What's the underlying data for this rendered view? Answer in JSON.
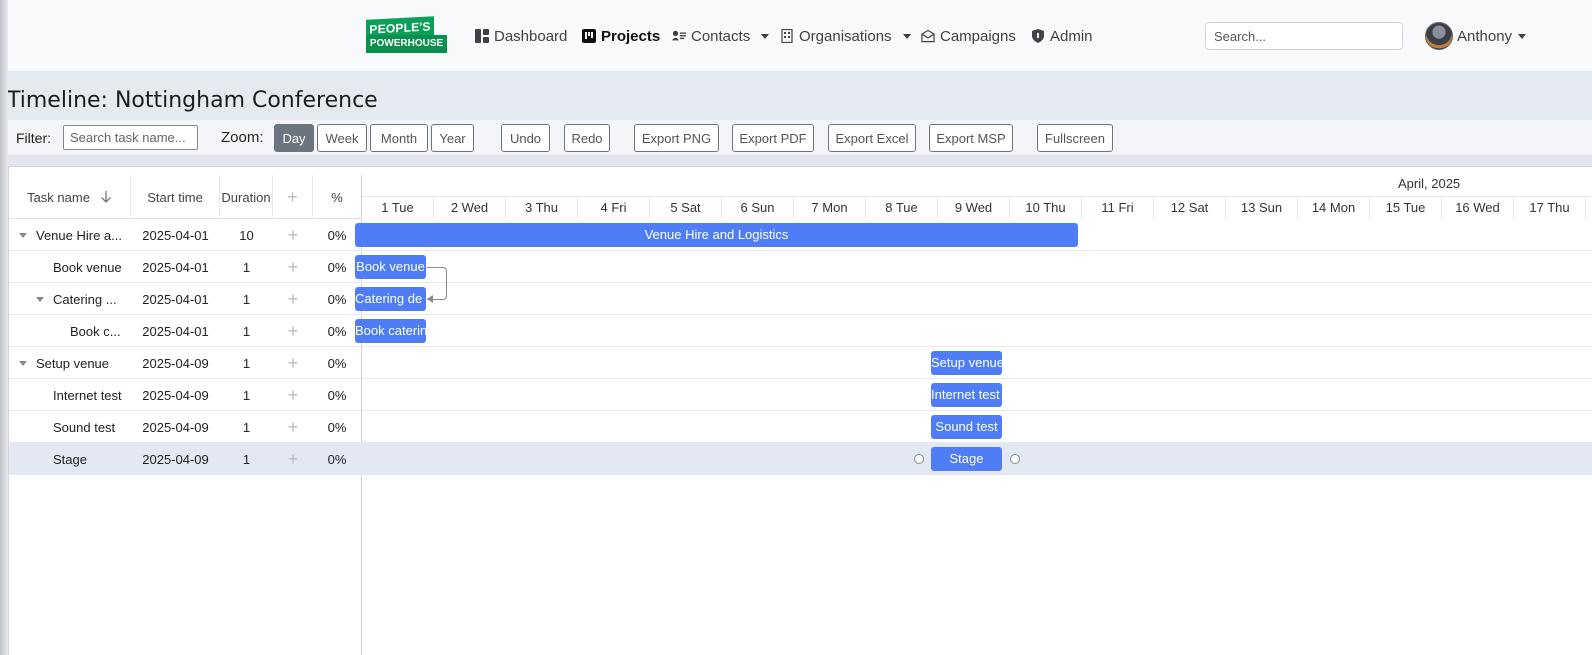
{
  "nav": {
    "logo_line1": "PEOPLE'S",
    "logo_line2": "POWERHOUSE",
    "items": [
      {
        "label": "Dashboard",
        "icon": "dashboard-icon"
      },
      {
        "label": "Projects",
        "icon": "projects-icon",
        "active": true
      },
      {
        "label": "Contacts",
        "icon": "contacts-icon",
        "dropdown": true
      },
      {
        "label": "Organisations",
        "icon": "building-icon",
        "dropdown": true
      },
      {
        "label": "Campaigns",
        "icon": "campaigns-icon"
      },
      {
        "label": "Admin",
        "icon": "shield-icon"
      }
    ],
    "search_placeholder": "Search...",
    "user_name": "Anthony"
  },
  "page": {
    "title": "Timeline: Nottingham Conference"
  },
  "toolbar": {
    "filter_label": "Filter:",
    "filter_placeholder": "Search task name...",
    "zoom_label": "Zoom:",
    "zoom_options": [
      "Day",
      "Week",
      "Month",
      "Year"
    ],
    "zoom_selected": "Day",
    "undo": "Undo",
    "redo": "Redo",
    "export_png": "Export PNG",
    "export_pdf": "Export PDF",
    "export_excel": "Export Excel",
    "export_msp": "Export MSP",
    "fullscreen": "Fullscreen"
  },
  "gantt": {
    "columns": {
      "name": "Task name",
      "start": "Start time",
      "duration": "Duration",
      "add": "+",
      "progress": "%"
    },
    "month_label": "April, 2025",
    "days": [
      "1 Tue",
      "2 Wed",
      "3 Thu",
      "4 Fri",
      "5 Sat",
      "6 Sun",
      "7 Mon",
      "8 Tue",
      "9 Wed",
      "10 Thu",
      "11 Fri",
      "12 Sat",
      "13 Sun",
      "14 Mon",
      "15 Tue",
      "16 Wed",
      "17 Thu"
    ],
    "tasks": [
      {
        "name": "Venue Hire a...",
        "bar_label": "Venue Hire and Logistics",
        "start": "2025-04-01",
        "duration": "10",
        "progress": "0%",
        "level": 0,
        "parent": true
      },
      {
        "name": "Book venue",
        "bar_label": "Book venue",
        "start": "2025-04-01",
        "duration": "1",
        "progress": "0%",
        "level": 1,
        "parent": false
      },
      {
        "name": "Catering ...",
        "bar_label": "Catering de",
        "start": "2025-04-01",
        "duration": "1",
        "progress": "0%",
        "level": 1,
        "parent": true
      },
      {
        "name": "Book c...",
        "bar_label": "Book caterin",
        "start": "2025-04-01",
        "duration": "1",
        "progress": "0%",
        "level": 2,
        "parent": false
      },
      {
        "name": "Setup venue",
        "bar_label": "Setup venue",
        "start": "2025-04-09",
        "duration": "1",
        "progress": "0%",
        "level": 0,
        "parent": true
      },
      {
        "name": "Internet test",
        "bar_label": "Internet test",
        "start": "2025-04-09",
        "duration": "1",
        "progress": "0%",
        "level": 1,
        "parent": false
      },
      {
        "name": "Sound test",
        "bar_label": "Sound test",
        "start": "2025-04-09",
        "duration": "1",
        "progress": "0%",
        "level": 1,
        "parent": false
      },
      {
        "name": "Stage",
        "bar_label": "Stage",
        "start": "2025-04-09",
        "duration": "1",
        "progress": "0%",
        "level": 1,
        "parent": false,
        "selected": true
      }
    ],
    "bar_color": "#4f7df5"
  }
}
